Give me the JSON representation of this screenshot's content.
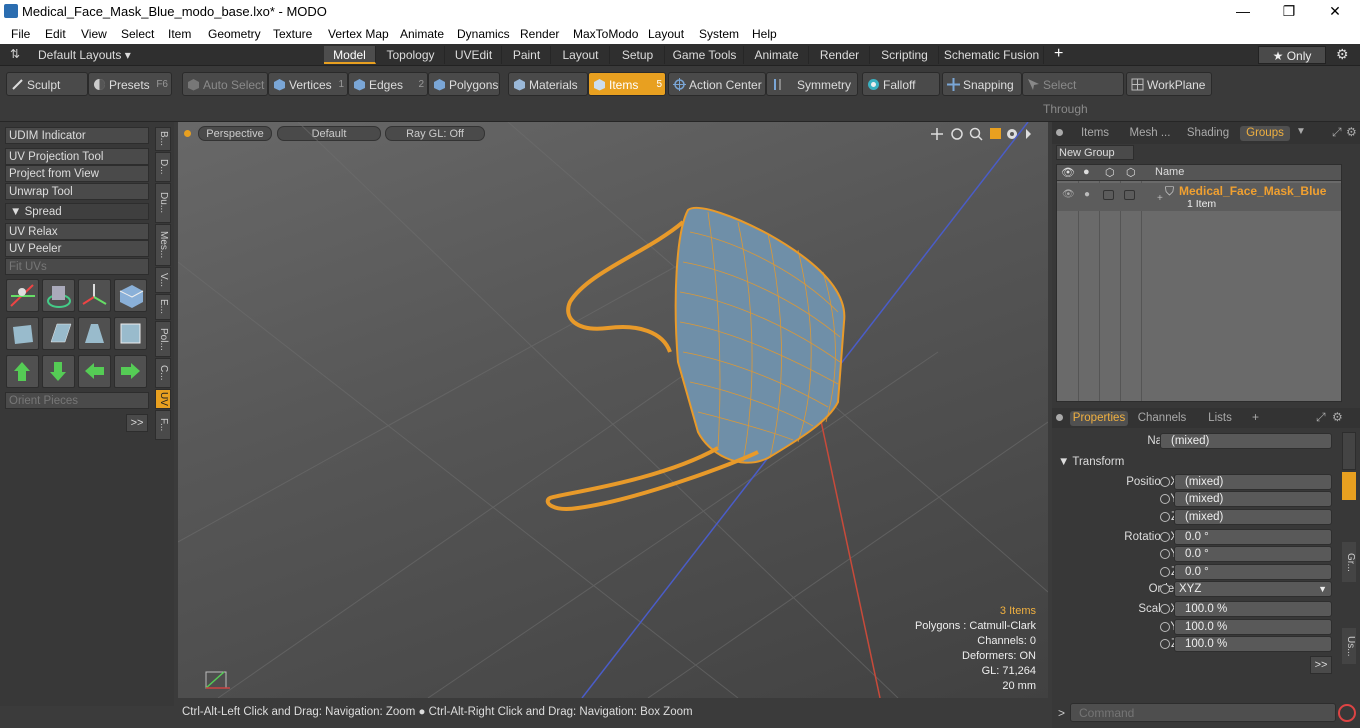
{
  "window": {
    "title": "Medical_Face_Mask_Blue_modo_base.lxo* - MODO",
    "minimize": "—",
    "maximize": "❐",
    "close": "✕"
  },
  "menu": [
    "File",
    "Edit",
    "View",
    "Select",
    "Item",
    "Geometry",
    "Texture",
    "Vertex Map",
    "Animate",
    "Dynamics",
    "Render",
    "MaxToModo",
    "Layout",
    "System",
    "Help"
  ],
  "layoutbar": {
    "layouts_label": "Default Layouts ▾",
    "tabs": [
      "Model",
      "Topology",
      "UVEdit",
      "Paint",
      "Layout",
      "Setup",
      "Game Tools",
      "Animate",
      "Render",
      "Scripting",
      "Schematic Fusion"
    ],
    "active": "Model",
    "add": "+",
    "only": "★  Only",
    "gear": "⚙"
  },
  "toolbar": {
    "sculpt": "Sculpt",
    "presets": "Presets",
    "presets_key": "F6",
    "auto_select": "Auto Select",
    "vertices": "Vertices",
    "vertices_n": "1",
    "edges": "Edges",
    "edges_n": "2",
    "polygons": "Polygons",
    "materials": "Materials",
    "items": "Items",
    "items_n": "5",
    "action_center": "Action Center",
    "symmetry": "Symmetry",
    "falloff": "Falloff",
    "snapping": "Snapping",
    "select_through": "Select Through",
    "workplane": "WorkPlane"
  },
  "leftpanel": {
    "buttons": [
      "UDIM Indicator",
      "UV Projection Tool",
      "Project from View",
      "Unwrap Tool",
      "▼  Spread",
      "UV Relax",
      "UV Peeler",
      "Fit UVs"
    ],
    "orient": "Orient Pieces",
    "more": ">>",
    "vtabs": [
      "B...",
      "D...",
      "Du...",
      "Mes...",
      "V...",
      "E...",
      "Pol...",
      "C...",
      "UV",
      "F..."
    ]
  },
  "viewport": {
    "header": {
      "perspective": "Perspective",
      "default": "Default",
      "raygl": "Ray GL: Off"
    },
    "info": {
      "items": "3 Items",
      "polygons": "Polygons : Catmull-Clark",
      "channels": "Channels: 0",
      "deformers": "Deformers: ON",
      "gl": "GL: 71,264",
      "scale": "20 mm"
    }
  },
  "statusbar": "Ctrl-Alt-Left Click and Drag: Navigation: Zoom ● Ctrl-Alt-Right Click and Drag: Navigation: Box Zoom",
  "groups": {
    "tabs": [
      "Items",
      "Mesh ...",
      "Shading",
      "Groups"
    ],
    "active": "Groups",
    "new_group": "New Group",
    "col_name": "Name",
    "item_name": "Medical_Face_Mask_Blue",
    "item_sub": "1 Item"
  },
  "properties": {
    "tabs": [
      "Properties",
      "Channels",
      "Lists"
    ],
    "add": "+",
    "name_label": "Name",
    "name_value": "(mixed)",
    "transform": "▼  Transform",
    "position_x_label": "Position X",
    "pos_x": "(mixed)",
    "y_label": "Y",
    "pos_y": "(mixed)",
    "z_label": "Z",
    "pos_z": "(mixed)",
    "rotation_x_label": "Rotation X",
    "rot_x": "0.0 °",
    "rot_y": "0.0 °",
    "rot_z": "0.0 °",
    "order_label": "Order",
    "order_value": "XYZ",
    "scale_x_label": "Scale X",
    "scl_x": "100.0 %",
    "scl_y": "100.0 %",
    "scl_z": "100.0 %",
    "more": ">>",
    "side_tabs": [
      "Gr...",
      "Us..."
    ]
  },
  "command": {
    "prompt": ">",
    "placeholder": "Command"
  }
}
